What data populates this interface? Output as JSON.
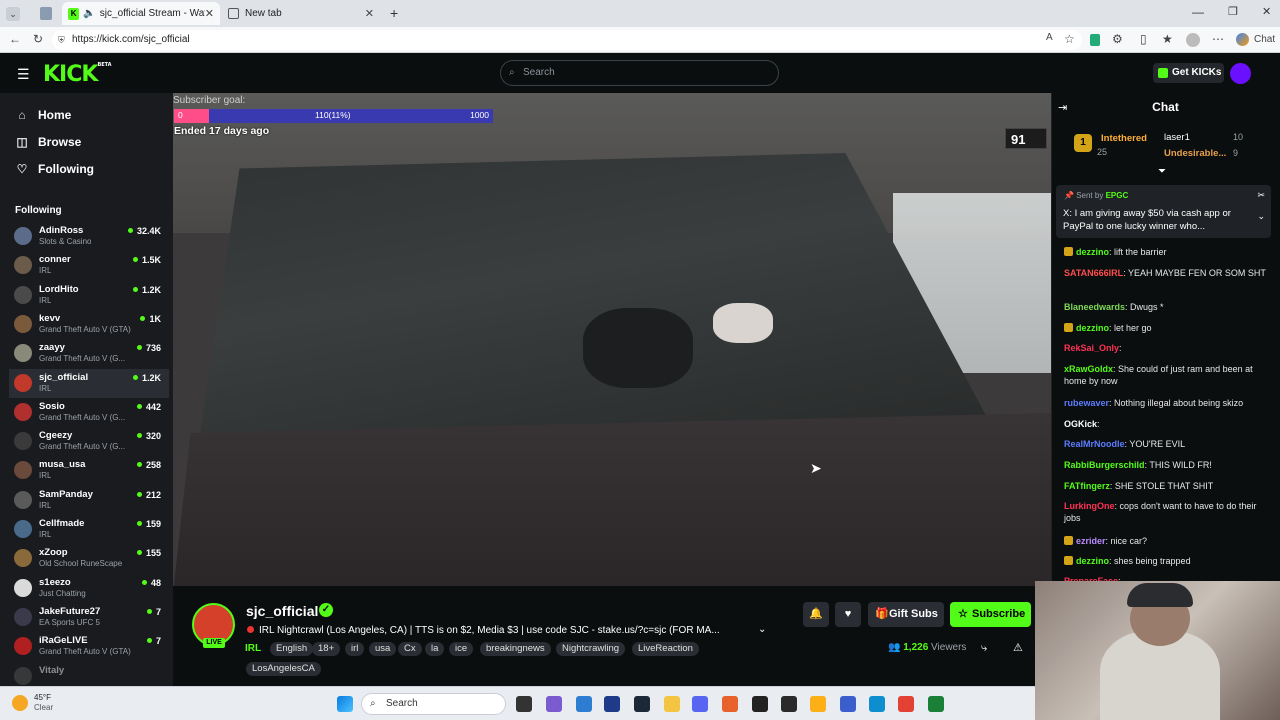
{
  "browser": {
    "tabs": [
      {
        "label": "sjc_official Stream - Watch Li..."
      },
      {
        "label": "New tab"
      }
    ],
    "url": "https://kick.com/sjc_official",
    "chat_label": "Chat"
  },
  "header": {
    "logo": "KICK",
    "logo_beta": "BETA",
    "search_placeholder": "Search",
    "get_kicks": "Get KICKs"
  },
  "nav": {
    "home": "Home",
    "browse": "Browse",
    "following": "Following"
  },
  "following": {
    "heading": "Following",
    "channels": [
      {
        "name": "AdinRoss",
        "category": "Slots & Casino",
        "viewers": "32.4K",
        "color": "#5b6b8a"
      },
      {
        "name": "conner",
        "category": "IRL",
        "viewers": "1.5K",
        "color": "#6b5b4a"
      },
      {
        "name": "LordHito",
        "category": "IRL",
        "viewers": "1.2K",
        "color": "#4a4a4a"
      },
      {
        "name": "kevv",
        "category": "Grand Theft Auto V (GTA)",
        "viewers": "1K",
        "color": "#7a5a3a"
      },
      {
        "name": "zaayy",
        "category": "Grand Theft Auto V (G...",
        "viewers": "736",
        "color": "#8a8a7a"
      },
      {
        "name": "sjc_official",
        "category": "IRL",
        "viewers": "1.2K",
        "color": "#c0392b"
      },
      {
        "name": "Sosio",
        "category": "Grand Theft Auto V (G...",
        "viewers": "442",
        "color": "#b03030"
      },
      {
        "name": "Cgeezy",
        "category": "Grand Theft Auto V (G...",
        "viewers": "320",
        "color": "#3a3a3a"
      },
      {
        "name": "musa_usa",
        "category": "IRL",
        "viewers": "258",
        "color": "#6a4a3a"
      },
      {
        "name": "SamPanday",
        "category": "IRL",
        "viewers": "212",
        "color": "#5a5a5a"
      },
      {
        "name": "Cellfmade",
        "category": "IRL",
        "viewers": "159",
        "color": "#4a6a8a"
      },
      {
        "name": "xZoop",
        "category": "Old School RuneScape",
        "viewers": "155",
        "color": "#8a6a3a"
      },
      {
        "name": "s1eezo",
        "category": "Just Chatting",
        "viewers": "48",
        "color": "#dadada"
      },
      {
        "name": "JakeFuture27",
        "category": "EA Sports UFC 5",
        "viewers": "7",
        "color": "#3a3a4a"
      },
      {
        "name": "iRaGeLIVE",
        "category": "Grand Theft Auto V (GTA)",
        "viewers": "7",
        "color": "#b02020"
      },
      {
        "name": "Vitaly",
        "category": "",
        "viewers": "",
        "color": "#555555"
      }
    ]
  },
  "player": {
    "goal_label": "Subscriber goal:",
    "goal_start": "0",
    "goal_progress": "110(11%)",
    "goal_end": "1000",
    "goal_fraction": 0.11,
    "ended": "Ended 17 days ago",
    "counter": "91"
  },
  "stream": {
    "streamer": "sjc_official",
    "live": "LIVE",
    "title": "IRL Nightcrawl (Los Angeles, CA) | TTS is on $2, Media $3 | use code SJC - stake.us/?c=sjc (FOR MA...",
    "category": "IRL",
    "tags": [
      "English",
      "18+",
      "irl",
      "usa",
      "Cx",
      "la",
      "ice",
      "breakingnews",
      "Nightcrawling",
      "LiveReaction",
      "LosAngelesCA"
    ],
    "gift_subs": "Gift Subs",
    "subscribe": "Subscribe",
    "viewers_count": "1,226",
    "viewers_label": "Viewers"
  },
  "chat": {
    "title": "Chat",
    "leaderboard": [
      {
        "rank": "1",
        "name": "Intethered",
        "value": "25"
      },
      {
        "name": "laser1",
        "value": "10"
      },
      {
        "name": "Undesirable...",
        "value": "9"
      }
    ],
    "pinned_sender_label": "Sent by",
    "pinned_sender": "EPGC",
    "pinned_text": "X: I am giving away $50 via cash app or PayPal to one lucky winner who...",
    "messages": [
      {
        "user": "dezzino",
        "color": "#53fc18",
        "text": "lift the barrier"
      },
      {
        "user": "SATAN666IRL",
        "color": "#ff4d4d",
        "text": "YEAH MAYBE FEN OR SOM SHT"
      },
      {
        "user": "Blaneedwards",
        "color": "#7ed957",
        "text": "Dwugs *"
      },
      {
        "user": "dezzino",
        "color": "#53fc18",
        "text": "let her go"
      },
      {
        "user": "RekSai_Only",
        "color": "#ff3355",
        "text": ""
      },
      {
        "user": "xRawGoldx",
        "color": "#53fc18",
        "text": "She could of just ram and been at home by now"
      },
      {
        "user": "rubewaver",
        "color": "#5c7cff",
        "text": "Nothing illegal about being skizo"
      },
      {
        "user": "OGKick",
        "color": "#ffffff",
        "text": ""
      },
      {
        "user": "RealMrNoodle",
        "color": "#5c7cff",
        "text": "YOU'RE EVIL"
      },
      {
        "user": "RabbiBurgerschild",
        "color": "#53fc18",
        "text": "THIS WILD FR!"
      },
      {
        "user": "FATfingerz",
        "color": "#53fc18",
        "text": "SHE STOLE THAT SHIT"
      },
      {
        "user": "LurkingOne",
        "color": "#ff3355",
        "text": "cops don't want to have to do their jobs"
      },
      {
        "user": "ezrider",
        "color": "#b98cff",
        "text": "nice car?"
      },
      {
        "user": "dezzino",
        "color": "#53fc18",
        "text": "shes being trapped"
      },
      {
        "user": "PrepareFace",
        "color": "#ff3355",
        "text": ""
      }
    ]
  },
  "taskbar": {
    "temp": "45°F",
    "condition": "Clear",
    "search": "Search"
  },
  "colors": {
    "accent": "#53fc18",
    "sidebar": "#191b1f",
    "background": "#0b0e0f"
  }
}
